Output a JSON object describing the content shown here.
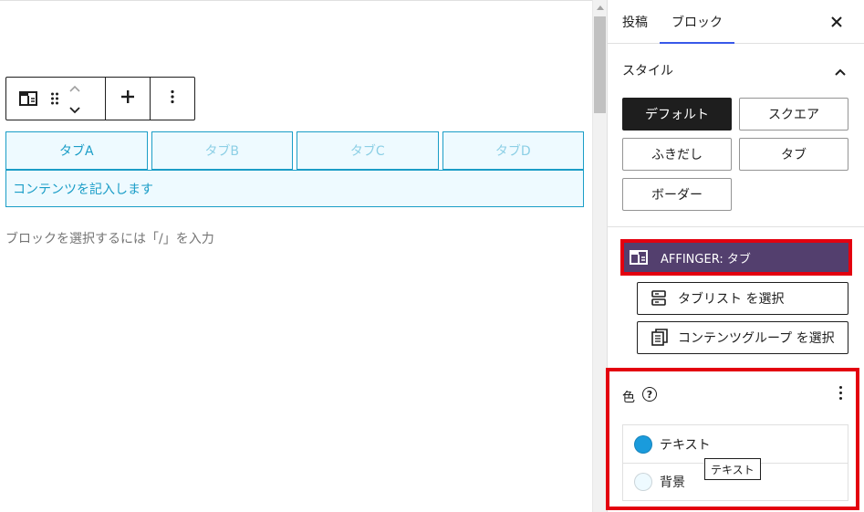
{
  "editor": {
    "tabs": [
      {
        "label": "タブA",
        "active": true
      },
      {
        "label": "タブB",
        "active": false
      },
      {
        "label": "タブC",
        "active": false
      },
      {
        "label": "タブD",
        "active": false
      }
    ],
    "tab_content": "コンテンツを記入します",
    "block_placeholder": "ブロックを選択するには「/」を入力",
    "toolbar": {
      "block_icon": "tab-block-icon",
      "drag_icon": "drag-handle-icon",
      "move_up_icon": "chevron-up-icon",
      "move_down_icon": "chevron-down-icon",
      "add_icon": "plus-icon",
      "options_icon": "more-vertical-icon"
    },
    "tab_color": "#1a9dc7",
    "tab_bg": "#eefaff"
  },
  "sidebar": {
    "tabs": {
      "posts": "投稿",
      "block": "ブロック"
    },
    "close_icon": "close-icon",
    "style_panel": {
      "title": "スタイル",
      "options": [
        "デフォルト",
        "スクエア",
        "ふきだし",
        "タブ",
        "ボーダー"
      ],
      "selected": "デフォルト"
    },
    "block_card": {
      "label": "AFFINGER: タブ",
      "bg": "#533f6e"
    },
    "select_buttons": {
      "tablist": "タブリスト を選択",
      "content_group": "コンテンツグループ を選択"
    },
    "color_panel": {
      "title": "色",
      "items": [
        {
          "label": "テキスト",
          "swatch": "#1a9bdc"
        },
        {
          "label": "背景",
          "swatch": "#eefaff"
        }
      ],
      "tooltip": "テキスト"
    },
    "highlight_color": "#e3000f"
  }
}
